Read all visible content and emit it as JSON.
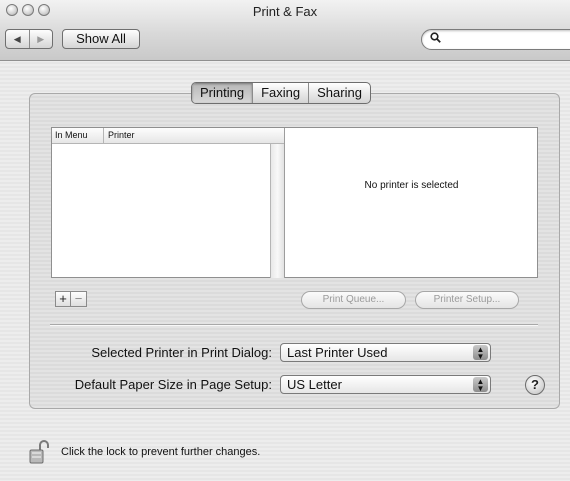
{
  "window": {
    "title": "Print & Fax"
  },
  "toolbar": {
    "back_label": "◀",
    "forward_label": "▶",
    "show_all_label": "Show All",
    "search_icon": "magnifier-icon",
    "search_value": ""
  },
  "tabs": [
    {
      "label": "Printing",
      "selected": true
    },
    {
      "label": "Faxing",
      "selected": false
    },
    {
      "label": "Sharing",
      "selected": false
    }
  ],
  "printer_list": {
    "columns": [
      "In Menu",
      "Printer"
    ],
    "rows": [],
    "detail_text": "No printer is selected"
  },
  "list_controls": {
    "add_label": "+",
    "remove_label": "−"
  },
  "actions": {
    "print_queue_label": "Print Queue...",
    "printer_setup_label": "Printer Setup..."
  },
  "settings": {
    "selected_printer_label": "Selected Printer in Print Dialog:",
    "selected_printer_value": "Last Printer Used",
    "paper_size_label": "Default Paper Size in Page Setup:",
    "paper_size_value": "US Letter"
  },
  "help_label": "?",
  "lock_text": "Click the lock to prevent further changes."
}
